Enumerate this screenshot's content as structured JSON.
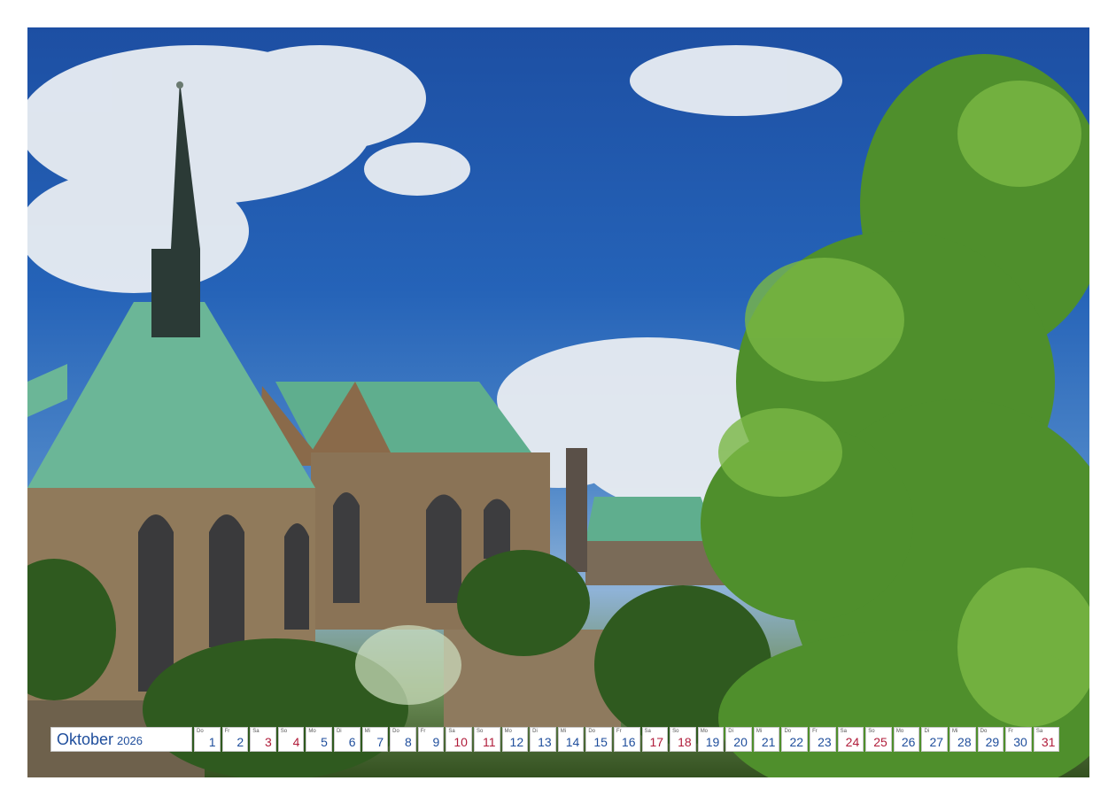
{
  "calendar": {
    "month": "Oktober",
    "year": "2026",
    "days": [
      {
        "wd": "Do",
        "n": "1",
        "we": false
      },
      {
        "wd": "Fr",
        "n": "2",
        "we": false
      },
      {
        "wd": "Sa",
        "n": "3",
        "we": true
      },
      {
        "wd": "So",
        "n": "4",
        "we": true
      },
      {
        "wd": "Mo",
        "n": "5",
        "we": false
      },
      {
        "wd": "Di",
        "n": "6",
        "we": false
      },
      {
        "wd": "Mi",
        "n": "7",
        "we": false
      },
      {
        "wd": "Do",
        "n": "8",
        "we": false
      },
      {
        "wd": "Fr",
        "n": "9",
        "we": false
      },
      {
        "wd": "Sa",
        "n": "10",
        "we": true
      },
      {
        "wd": "So",
        "n": "11",
        "we": true
      },
      {
        "wd": "Mo",
        "n": "12",
        "we": false
      },
      {
        "wd": "Di",
        "n": "13",
        "we": false
      },
      {
        "wd": "Mi",
        "n": "14",
        "we": false
      },
      {
        "wd": "Do",
        "n": "15",
        "we": false
      },
      {
        "wd": "Fr",
        "n": "16",
        "we": false
      },
      {
        "wd": "Sa",
        "n": "17",
        "we": true
      },
      {
        "wd": "So",
        "n": "18",
        "we": true
      },
      {
        "wd": "Mo",
        "n": "19",
        "we": false
      },
      {
        "wd": "Di",
        "n": "20",
        "we": false
      },
      {
        "wd": "Mi",
        "n": "21",
        "we": false
      },
      {
        "wd": "Do",
        "n": "22",
        "we": false
      },
      {
        "wd": "Fr",
        "n": "23",
        "we": false
      },
      {
        "wd": "Sa",
        "n": "24",
        "we": true
      },
      {
        "wd": "So",
        "n": "25",
        "we": true
      },
      {
        "wd": "Mo",
        "n": "26",
        "we": false
      },
      {
        "wd": "Di",
        "n": "27",
        "we": false
      },
      {
        "wd": "Mi",
        "n": "28",
        "we": false
      },
      {
        "wd": "Do",
        "n": "29",
        "we": false
      },
      {
        "wd": "Fr",
        "n": "30",
        "we": false
      },
      {
        "wd": "Sa",
        "n": "31",
        "we": true
      }
    ]
  },
  "colors": {
    "weekday": "#1f4e9c",
    "weekend": "#b01c3a",
    "sky": "#2563b8",
    "roof": "#5fae8e",
    "stone": "#8a7356"
  }
}
